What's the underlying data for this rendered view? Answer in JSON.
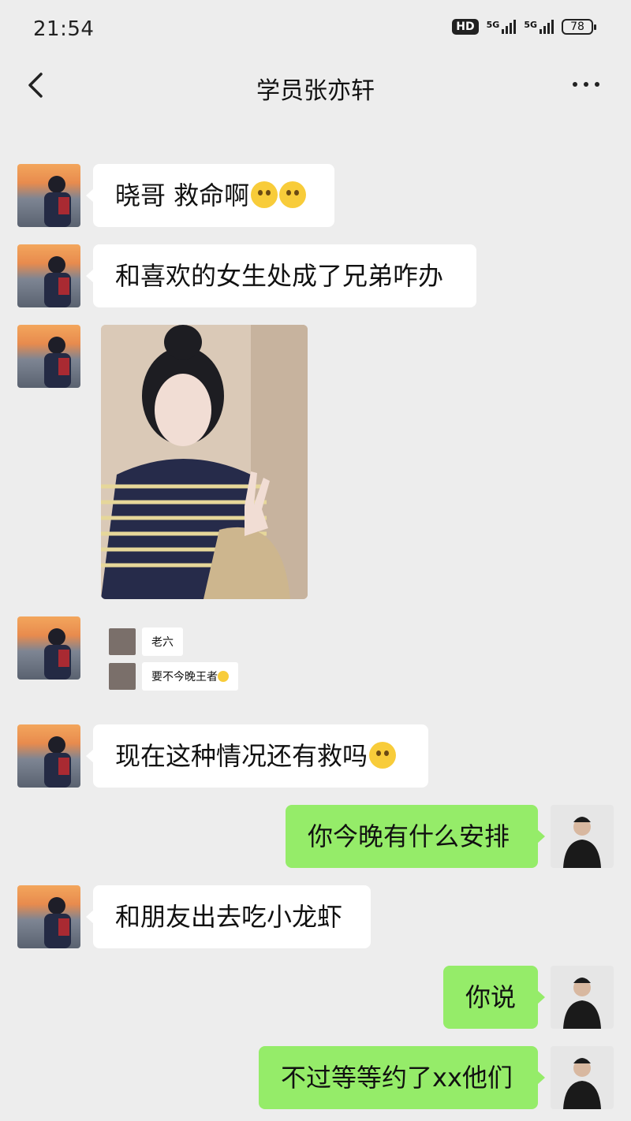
{
  "status": {
    "time": "21:54",
    "hd": "HD",
    "net1": "5G",
    "net2": "5G",
    "battery": "78"
  },
  "header": {
    "title": "学员张亦轩"
  },
  "messages": {
    "m1": "晓哥 救命啊",
    "m2": "和喜欢的女生处成了兄弟咋办",
    "mini1": "老六",
    "mini2": "要不今晚王者",
    "m4": "现在这种情况还有救吗",
    "m5": "你今晚有什么安排",
    "m6": "和朋友出去吃小龙虾",
    "m7": "你说",
    "m8": "不过等等约了xx他们"
  },
  "colors": {
    "background": "#ededed",
    "bubble_in": "#ffffff",
    "bubble_out": "#95ec69"
  }
}
